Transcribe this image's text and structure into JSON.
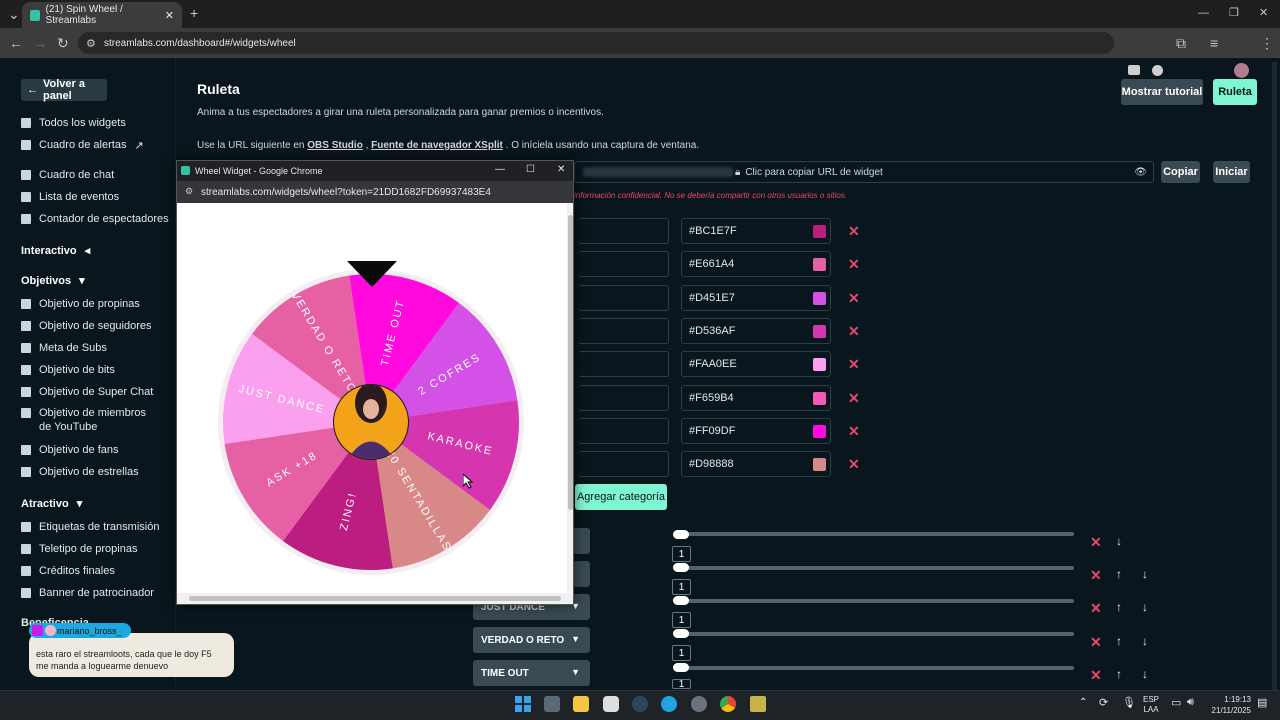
{
  "browser": {
    "tab_title": "(21) Spin Wheel / Streamlabs",
    "url": "streamlabs.com/dashboard#/widgets/wheel"
  },
  "sidebar": {
    "back_label": "Volver a panel",
    "items_top": [
      "Todos los widgets",
      "Cuadro de alertas"
    ],
    "items_mid": [
      "Cuadro de chat",
      "Lista de eventos",
      "Contador de espectadores"
    ],
    "section_interactivo": "Interactivo",
    "section_objetivos": "Objetivos",
    "objetivos": [
      "Objetivo de propinas",
      "Objetivo de seguidores",
      "Meta de Subs",
      "Objetivo de bits",
      "Objetivo de Super Chat",
      "Objetivo de miembros de YouTube",
      "Objetivo de fans",
      "Objetivo de estrellas"
    ],
    "section_atractivo": "Atractivo",
    "atractivo": [
      "Etiquetas de transmisión",
      "Teletipo de propinas",
      "Créditos finales",
      "Banner de patrocinador"
    ],
    "section_partial": "Beneficencia"
  },
  "main": {
    "title": "Ruleta",
    "description": "Anima a tus espectadores a girar una ruleta personalizada para ganar premios o incentivos.",
    "url_hint_prefix": "Use la URL siguiente en",
    "url_hint_link1": "OBS Studio",
    "url_hint_link2": "Fuente de navegador XSplit",
    "url_hint_suffix": ". O iníciela usando una captura de ventana.",
    "tutorial_button": "Mostrar tutorial",
    "ruleta_button": "Ruleta",
    "url_field_label": "Clic para copiar URL de widget",
    "copy_button": "Copiar",
    "start_button": "Iniciar",
    "warning": "información confidencial. No se debería compartir con otros usuarios o sitios.",
    "colors": [
      "#BC1E7F",
      "#E661A4",
      "#D451E7",
      "#D536AF",
      "#FAA0EE",
      "#F659B4",
      "#FF09DF",
      "#D98888"
    ],
    "add_category_button": "Agregar categoría",
    "dropdown_labels": [
      "JUST DANCE",
      "VERDAD O RETO",
      "TIME OUT"
    ],
    "slider_values": [
      "1",
      "1",
      "1",
      "1",
      "1"
    ]
  },
  "popup": {
    "window_title": "Wheel Widget - Google Chrome",
    "url": "streamlabs.com/widgets/wheel?token=21DD1682FD69937483E4",
    "wheel_segments": [
      {
        "label": "TIME OUT",
        "color": "#FF09DF"
      },
      {
        "label": "2 COFRES",
        "color": "#D451E7"
      },
      {
        "label": "KARAOKE",
        "color": "#D536AF"
      },
      {
        "label": "20 SENTADILLAS",
        "color": "#D98888"
      },
      {
        "label": "ZING!",
        "color": "#BC1E7F"
      },
      {
        "label": "ASK +18",
        "color": "#E661A4"
      },
      {
        "label": "JUST DANCE",
        "color": "#FAA0EE"
      },
      {
        "label": "VERDAD O RETO",
        "color": "#E661A4"
      }
    ]
  },
  "chat": {
    "username": "mariano_bross_",
    "message": "esta raro el streamloots, cada que le doy F5 me manda a loguearme denuevo"
  },
  "taskbar": {
    "lang_top": "ESP",
    "lang_bottom": "LAA",
    "time": "1:19:13",
    "date": "21/11/2025"
  }
}
